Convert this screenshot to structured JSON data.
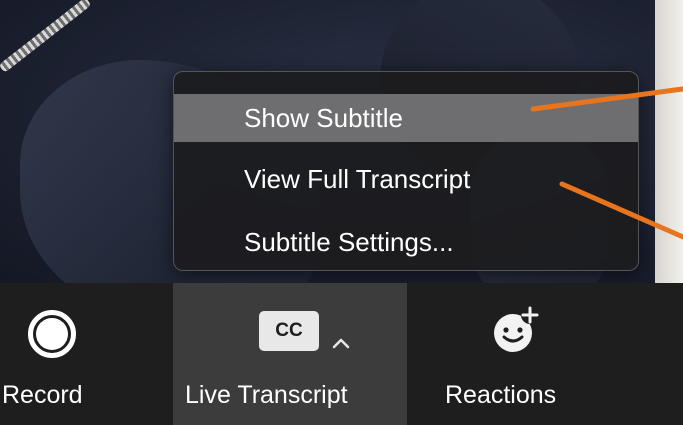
{
  "menu": {
    "items": [
      {
        "label": "Show Subtitle",
        "active": true
      },
      {
        "label": "View Full Transcript",
        "active": false
      },
      {
        "label": "Subtitle Settings...",
        "active": false
      }
    ]
  },
  "toolbar": {
    "record_label": "Record",
    "transcript_label": "Live Transcript",
    "transcript_icon_text": "CC",
    "reactions_label": "Reactions"
  },
  "colors": {
    "annotation_arrow": "#e8741e",
    "active_item_bg": "#6e6e70",
    "toolbar_bg": "#1e1e1e",
    "selected_button_bg": "#3c3c3c"
  },
  "icons": [
    "record-icon",
    "cc-icon",
    "chevron-up-icon",
    "reaction-add-icon"
  ]
}
